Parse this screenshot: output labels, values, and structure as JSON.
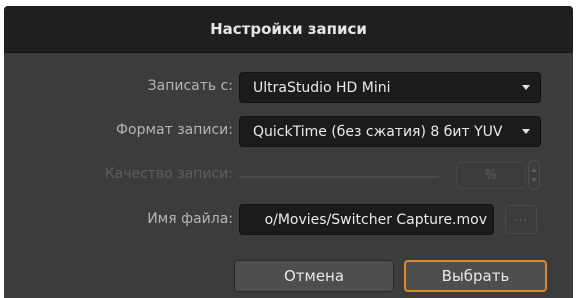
{
  "dialog": {
    "title": "Настройки записи"
  },
  "record_from": {
    "label": "Записать с:",
    "value": "UltraStudio HD Mini"
  },
  "record_format": {
    "label": "Формат записи:",
    "value": "QuickTime (без сжатия) 8 бит YUV"
  },
  "record_quality": {
    "label": "Качество записи:",
    "percent_symbol": "%",
    "enabled": false
  },
  "file_name": {
    "label": "Имя файла:",
    "value": "o/Movies/Switcher Capture.mov",
    "browse_label": "···"
  },
  "buttons": {
    "cancel": "Отмена",
    "ok": "Выбрать"
  },
  "colors": {
    "dialog_bg": "#3c3c3c",
    "titlebar_bg": "#1f1f1f",
    "field_bg": "#1b1b1b",
    "accent": "#d98a2b"
  },
  "icons": {
    "dropdown": "chevron-down-icon",
    "stepper": "stepper-icon"
  }
}
